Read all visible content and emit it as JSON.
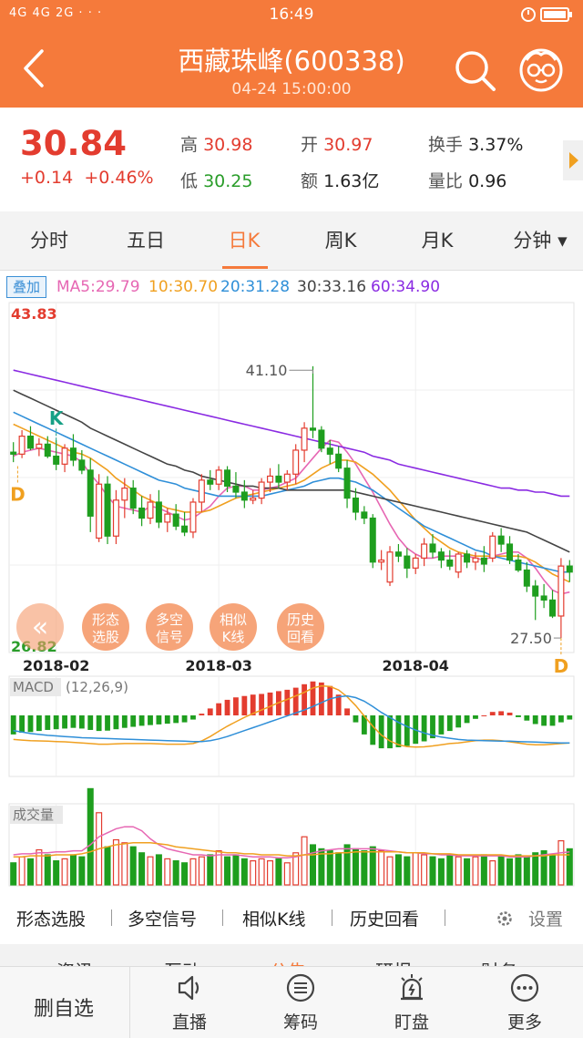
{
  "status_bar": {
    "signal": "4G  4G  2G  · · ·",
    "time": "16:49"
  },
  "header": {
    "title": "西藏珠峰(600338)",
    "datetime": "04-24 15:00:00"
  },
  "quote": {
    "price": "30.84",
    "change": "+0.14",
    "change_pct": "+0.46%",
    "high_label": "高",
    "high": "30.98",
    "low_label": "低",
    "low": "30.25",
    "open_label": "开",
    "open": "30.97",
    "amount_label": "额",
    "amount": "1.63亿",
    "turnover_label": "换手",
    "turnover": "3.37%",
    "vol_ratio_label": "量比",
    "vol_ratio": "0.96"
  },
  "tabs": [
    {
      "label": "分时",
      "active": false
    },
    {
      "label": "五日",
      "active": false
    },
    {
      "label": "日K",
      "active": true
    },
    {
      "label": "周K",
      "active": false
    },
    {
      "label": "月K",
      "active": false
    },
    {
      "label": "分钟 ▾",
      "active": false
    }
  ],
  "legend": {
    "overlay_button": "叠加",
    "ma": [
      {
        "text": "MA5:29.79",
        "color": "#e667b3"
      },
      {
        "text": "10:30.70",
        "color": "#f0a020"
      },
      {
        "text": "20:31.28",
        "color": "#2f8fd8"
      },
      {
        "text": "30:33.16",
        "color": "#444444"
      },
      {
        "text": "60:34.90",
        "color": "#8a2be2"
      }
    ]
  },
  "chart_data": {
    "type": "candlestick",
    "y_axis": {
      "max_label": "43.83",
      "min_label": "26.82",
      "ylim": [
        26.82,
        43.83
      ]
    },
    "x_labels": [
      "2018-02",
      "2018-03",
      "2018-04"
    ],
    "annotations": [
      {
        "text": "41.10",
        "kind": "high"
      },
      {
        "text": "27.50",
        "kind": "low"
      },
      {
        "text": "K",
        "color": "#16a085"
      },
      {
        "text": "D",
        "color": "#f0a020"
      },
      {
        "text": "D",
        "color": "#f0a020"
      }
    ],
    "candles": [
      [
        36.8,
        37.3,
        36.3,
        36.7
      ],
      [
        36.7,
        37.9,
        36.5,
        37.6
      ],
      [
        37.6,
        38.1,
        36.9,
        37.0
      ],
      [
        37.0,
        37.5,
        36.6,
        37.2
      ],
      [
        37.2,
        37.6,
        36.5,
        36.6
      ],
      [
        36.6,
        37.4,
        35.9,
        36.2
      ],
      [
        36.2,
        37.2,
        35.8,
        37.0
      ],
      [
        37.0,
        37.7,
        36.1,
        36.4
      ],
      [
        36.4,
        36.9,
        35.7,
        35.9
      ],
      [
        35.9,
        36.5,
        32.8,
        33.6
      ],
      [
        32.5,
        35.7,
        32.3,
        35.2
      ],
      [
        35.2,
        35.6,
        32.2,
        32.6
      ],
      [
        32.6,
        34.9,
        32.2,
        34.4
      ],
      [
        34.4,
        35.5,
        33.5,
        35.0
      ],
      [
        35.0,
        35.4,
        33.7,
        34.0
      ],
      [
        34.0,
        34.6,
        33.1,
        33.5
      ],
      [
        33.5,
        34.7,
        33.2,
        34.3
      ],
      [
        34.3,
        34.9,
        33.0,
        33.3
      ],
      [
        33.3,
        34.0,
        32.8,
        33.7
      ],
      [
        33.7,
        34.2,
        32.9,
        33.1
      ],
      [
        33.1,
        33.8,
        32.6,
        32.8
      ],
      [
        32.8,
        34.5,
        32.5,
        34.3
      ],
      [
        34.3,
        35.7,
        33.8,
        35.4
      ],
      [
        35.4,
        35.9,
        34.9,
        35.2
      ],
      [
        35.2,
        36.1,
        34.9,
        35.9
      ],
      [
        35.9,
        36.1,
        34.8,
        35.1
      ],
      [
        35.1,
        35.8,
        34.5,
        34.8
      ],
      [
        34.8,
        35.4,
        34.0,
        34.4
      ],
      [
        34.4,
        34.9,
        34.2,
        34.5
      ],
      [
        34.5,
        35.5,
        34.2,
        35.3
      ],
      [
        35.3,
        36.0,
        34.8,
        35.6
      ],
      [
        35.6,
        36.2,
        35.0,
        35.3
      ],
      [
        35.3,
        35.9,
        34.9,
        35.7
      ],
      [
        35.7,
        37.2,
        35.2,
        36.9
      ],
      [
        36.9,
        38.3,
        36.3,
        38.0
      ],
      [
        38.0,
        41.1,
        37.5,
        37.9
      ],
      [
        37.9,
        38.1,
        36.8,
        37.0
      ],
      [
        37.0,
        37.4,
        36.2,
        36.7
      ],
      [
        36.7,
        37.1,
        35.8,
        36.0
      ],
      [
        36.0,
        36.4,
        34.0,
        34.5
      ],
      [
        34.5,
        35.0,
        33.4,
        33.8
      ],
      [
        33.8,
        34.1,
        33.2,
        33.5
      ],
      [
        33.5,
        33.7,
        31.0,
        31.3
      ],
      [
        31.3,
        31.9,
        30.9,
        31.4
      ],
      [
        30.3,
        32.1,
        30.1,
        31.8
      ],
      [
        31.8,
        32.2,
        31.3,
        31.6
      ],
      [
        31.6,
        32.0,
        30.5,
        31.0
      ],
      [
        31.0,
        31.7,
        30.7,
        31.5
      ],
      [
        31.5,
        32.5,
        31.1,
        32.2
      ],
      [
        32.2,
        32.7,
        31.5,
        31.8
      ],
      [
        31.8,
        32.0,
        31.0,
        31.4
      ],
      [
        31.4,
        31.9,
        30.9,
        31.1
      ],
      [
        30.8,
        31.8,
        30.5,
        31.7
      ],
      [
        31.7,
        31.9,
        31.0,
        31.3
      ],
      [
        31.3,
        31.8,
        30.9,
        31.5
      ],
      [
        31.5,
        32.1,
        30.8,
        31.2
      ],
      [
        31.5,
        32.8,
        31.3,
        32.6
      ],
      [
        32.6,
        33.0,
        31.8,
        32.2
      ],
      [
        32.2,
        32.6,
        31.2,
        31.4
      ],
      [
        31.4,
        31.7,
        30.8,
        30.9
      ],
      [
        30.9,
        31.3,
        29.8,
        30.1
      ],
      [
        30.1,
        30.4,
        28.4,
        29.6
      ],
      [
        29.6,
        30.2,
        29.0,
        29.4
      ],
      [
        29.4,
        29.9,
        28.5,
        28.6
      ],
      [
        28.6,
        31.5,
        27.5,
        31.1
      ],
      [
        31.1,
        31.4,
        30.3,
        30.8
      ]
    ],
    "ma_lines": {
      "ma5": [
        36.6,
        36.8,
        36.9,
        37.0,
        36.9,
        36.8,
        36.7,
        36.6,
        36.3,
        35.7,
        35.2,
        34.6,
        34.1,
        34.0,
        33.9,
        33.8,
        34.1,
        34.0,
        33.8,
        33.6,
        33.4,
        33.5,
        33.8,
        34.1,
        34.6,
        35.0,
        35.1,
        35.1,
        34.9,
        34.9,
        35.0,
        35.1,
        35.3,
        35.5,
        36.0,
        36.5,
        37.0,
        37.4,
        37.3,
        36.8,
        36.2,
        35.5,
        34.8,
        34.0,
        33.2,
        32.5,
        32.0,
        31.7,
        31.5,
        31.5,
        31.6,
        31.6,
        31.6,
        31.6,
        31.5,
        31.4,
        31.6,
        31.7,
        31.8,
        31.8,
        31.5,
        31.0,
        30.4,
        29.9,
        29.7,
        29.8
      ],
      "ma10": [
        38.2,
        38.0,
        37.8,
        37.6,
        37.4,
        37.2,
        37.0,
        36.8,
        36.7,
        36.5,
        36.2,
        35.9,
        35.5,
        35.2,
        34.9,
        34.6,
        34.4,
        34.2,
        34.0,
        33.9,
        33.8,
        33.8,
        33.8,
        33.9,
        34.1,
        34.3,
        34.5,
        34.6,
        34.7,
        34.8,
        34.9,
        35.0,
        35.1,
        35.2,
        35.4,
        35.7,
        36.0,
        36.2,
        36.4,
        36.4,
        36.3,
        36.0,
        35.7,
        35.3,
        34.9,
        34.4,
        33.9,
        33.4,
        33.0,
        32.6,
        32.3,
        32.0,
        31.8,
        31.7,
        31.6,
        31.6,
        31.6,
        31.6,
        31.6,
        31.6,
        31.5,
        31.3,
        31.0,
        30.7,
        30.5,
        30.3
      ],
      "ma20": [
        38.8,
        38.6,
        38.4,
        38.2,
        38.0,
        37.8,
        37.6,
        37.4,
        37.2,
        37.0,
        36.8,
        36.6,
        36.4,
        36.2,
        36.0,
        35.8,
        35.6,
        35.4,
        35.3,
        35.2,
        35.0,
        34.9,
        34.8,
        34.7,
        34.6,
        34.6,
        34.6,
        34.6,
        34.6,
        34.6,
        34.7,
        34.8,
        34.9,
        35.0,
        35.1,
        35.3,
        35.4,
        35.5,
        35.5,
        35.4,
        35.3,
        35.1,
        34.9,
        34.6,
        34.3,
        34.0,
        33.7,
        33.4,
        33.1,
        32.9,
        32.7,
        32.5,
        32.3,
        32.1,
        31.9,
        31.8,
        31.6,
        31.5,
        31.4,
        31.3,
        31.2,
        31.1,
        31.0,
        30.9,
        30.8,
        30.8
      ],
      "ma30": [
        39.9,
        39.7,
        39.5,
        39.3,
        39.1,
        38.9,
        38.7,
        38.5,
        38.3,
        38.0,
        37.8,
        37.6,
        37.4,
        37.2,
        37.0,
        36.8,
        36.6,
        36.4,
        36.2,
        36.1,
        35.9,
        35.8,
        35.6,
        35.5,
        35.4,
        35.3,
        35.2,
        35.1,
        35.1,
        35.0,
        35.0,
        35.0,
        34.9,
        34.9,
        34.9,
        34.9,
        34.9,
        34.9,
        34.9,
        34.9,
        34.8,
        34.7,
        34.6,
        34.5,
        34.4,
        34.3,
        34.2,
        34.1,
        34.0,
        33.9,
        33.8,
        33.7,
        33.6,
        33.5,
        33.4,
        33.3,
        33.2,
        33.1,
        33.0,
        32.9,
        32.8,
        32.6,
        32.4,
        32.2,
        32.0,
        31.8
      ],
      "ma60": [
        40.9,
        40.8,
        40.7,
        40.6,
        40.5,
        40.4,
        40.3,
        40.2,
        40.1,
        40.0,
        39.9,
        39.8,
        39.7,
        39.6,
        39.5,
        39.4,
        39.3,
        39.2,
        39.1,
        39.0,
        38.9,
        38.8,
        38.7,
        38.6,
        38.5,
        38.4,
        38.3,
        38.2,
        38.1,
        38.0,
        37.9,
        37.8,
        37.7,
        37.6,
        37.5,
        37.4,
        37.3,
        37.2,
        37.1,
        37.0,
        36.9,
        36.8,
        36.6,
        36.5,
        36.4,
        36.2,
        36.1,
        36.0,
        35.9,
        35.8,
        35.7,
        35.6,
        35.5,
        35.4,
        35.3,
        35.2,
        35.1,
        35.0,
        35.0,
        34.9,
        34.9,
        34.8,
        34.8,
        34.7,
        34.6,
        34.6
      ]
    },
    "macd": {
      "label": "MACD",
      "params": "(12,26,9)",
      "hist": [
        -0.55,
        -0.5,
        -0.48,
        -0.45,
        -0.42,
        -0.4,
        -0.38,
        -0.36,
        -0.38,
        -0.42,
        -0.45,
        -0.44,
        -0.4,
        -0.36,
        -0.33,
        -0.3,
        -0.28,
        -0.26,
        -0.24,
        -0.22,
        -0.2,
        -0.12,
        0.05,
        0.2,
        0.35,
        0.45,
        0.52,
        0.56,
        0.6,
        0.62,
        0.66,
        0.7,
        0.74,
        0.8,
        0.9,
        0.98,
        0.95,
        0.85,
        0.6,
        0.2,
        -0.2,
        -0.55,
        -0.85,
        -0.95,
        -0.95,
        -0.92,
        -0.88,
        -0.82,
        -0.75,
        -0.66,
        -0.55,
        -0.45,
        -0.35,
        -0.22,
        -0.1,
        0.0,
        0.1,
        0.12,
        0.08,
        -0.05,
        -0.15,
        -0.25,
        -0.3,
        -0.3,
        -0.2,
        -0.12
      ],
      "dif": [
        -0.7,
        -0.72,
        -0.74,
        -0.75,
        -0.76,
        -0.77,
        -0.78,
        -0.8,
        -0.82,
        -0.84,
        -0.86,
        -0.86,
        -0.85,
        -0.84,
        -0.84,
        -0.84,
        -0.84,
        -0.85,
        -0.86,
        -0.86,
        -0.86,
        -0.84,
        -0.75,
        -0.6,
        -0.42,
        -0.25,
        -0.1,
        0.05,
        0.18,
        0.3,
        0.42,
        0.55,
        0.66,
        0.78,
        0.9,
        1.05,
        1.12,
        1.1,
        0.98,
        0.75,
        0.45,
        0.1,
        -0.25,
        -0.55,
        -0.75,
        -0.88,
        -0.94,
        -0.96,
        -0.95,
        -0.92,
        -0.88,
        -0.84,
        -0.82,
        -0.78,
        -0.74,
        -0.72,
        -0.72,
        -0.74,
        -0.78,
        -0.82,
        -0.86,
        -0.88,
        -0.88,
        -0.86,
        -0.84,
        -0.82
      ],
      "dea": [
        -0.4,
        -0.45,
        -0.5,
        -0.53,
        -0.56,
        -0.58,
        -0.6,
        -0.62,
        -0.64,
        -0.65,
        -0.66,
        -0.67,
        -0.68,
        -0.69,
        -0.7,
        -0.71,
        -0.72,
        -0.73,
        -0.74,
        -0.75,
        -0.76,
        -0.77,
        -0.77,
        -0.74,
        -0.68,
        -0.6,
        -0.5,
        -0.4,
        -0.3,
        -0.2,
        -0.1,
        0.0,
        0.1,
        0.2,
        0.3,
        0.42,
        0.55,
        0.68,
        0.75,
        0.78,
        0.72,
        0.6,
        0.42,
        0.22,
        0.05,
        -0.12,
        -0.26,
        -0.38,
        -0.48,
        -0.56,
        -0.62,
        -0.66,
        -0.7,
        -0.72,
        -0.73,
        -0.74,
        -0.75,
        -0.76,
        -0.76,
        -0.77,
        -0.78,
        -0.79,
        -0.8,
        -0.81,
        -0.82,
        -0.82
      ]
    },
    "volume": {
      "label": "成交量",
      "values": [
        22,
        28,
        26,
        35,
        30,
        24,
        26,
        30,
        28,
        96,
        72,
        38,
        45,
        42,
        38,
        32,
        28,
        30,
        26,
        24,
        22,
        26,
        28,
        30,
        34,
        28,
        30,
        26,
        24,
        26,
        24,
        26,
        22,
        32,
        48,
        40,
        36,
        34,
        32,
        40,
        36,
        34,
        38,
        34,
        28,
        30,
        28,
        32,
        30,
        28,
        26,
        30,
        28,
        26,
        28,
        30,
        24,
        28,
        26,
        30,
        28,
        32,
        34,
        30,
        44,
        36
      ],
      "ma1": [
        30,
        31,
        31,
        32,
        32,
        33,
        33,
        34,
        34,
        40,
        48,
        52,
        56,
        58,
        58,
        54,
        46,
        40,
        36,
        34,
        32,
        30,
        30,
        29,
        30,
        30,
        30,
        29,
        28,
        28,
        28,
        27,
        27,
        28,
        30,
        32,
        34,
        35,
        36,
        36,
        36,
        36,
        36,
        35,
        34,
        33,
        32,
        32,
        31,
        31,
        30,
        30,
        29,
        29,
        29,
        29,
        29,
        29,
        28,
        28,
        28,
        29,
        30,
        31,
        32,
        33
      ],
      "ma2": [
        28,
        28,
        29,
        29,
        29,
        30,
        30,
        30,
        31,
        33,
        36,
        38,
        40,
        41,
        42,
        42,
        42,
        41,
        40,
        38,
        37,
        36,
        35,
        34,
        33,
        32,
        32,
        31,
        31,
        30,
        30,
        30,
        29,
        29,
        30,
        30,
        31,
        31,
        32,
        32,
        33,
        33,
        33,
        33,
        33,
        33,
        32,
        32,
        32,
        31,
        31,
        31,
        30,
        30,
        30,
        30,
        30,
        30,
        29,
        29,
        29,
        29,
        29,
        30,
        30,
        30
      ]
    }
  },
  "chart_buttons": {
    "collapse": "«",
    "pattern": "形态\n选股",
    "signal": "多空\n信号",
    "similar": "相似\nK线",
    "history": "历史\n回看"
  },
  "toolbar": {
    "items": [
      "形态选股",
      "多空信号",
      "相似K线",
      "历史回看"
    ],
    "settings": "设置"
  },
  "lower_tabs_peek": [
    "资讯",
    "互动",
    "公告",
    "研报",
    "财务"
  ],
  "bottom_nav": [
    {
      "label": "删自选",
      "icon": ""
    },
    {
      "label": "直播",
      "icon": "speaker-icon"
    },
    {
      "label": "筹码",
      "icon": "chips-icon"
    },
    {
      "label": "盯盘",
      "icon": "alarm-icon"
    },
    {
      "label": "更多",
      "icon": "more-icon"
    }
  ],
  "colors": {
    "brand": "#f57a3b",
    "up": "#e33c2f",
    "down": "#1e9e1e"
  }
}
